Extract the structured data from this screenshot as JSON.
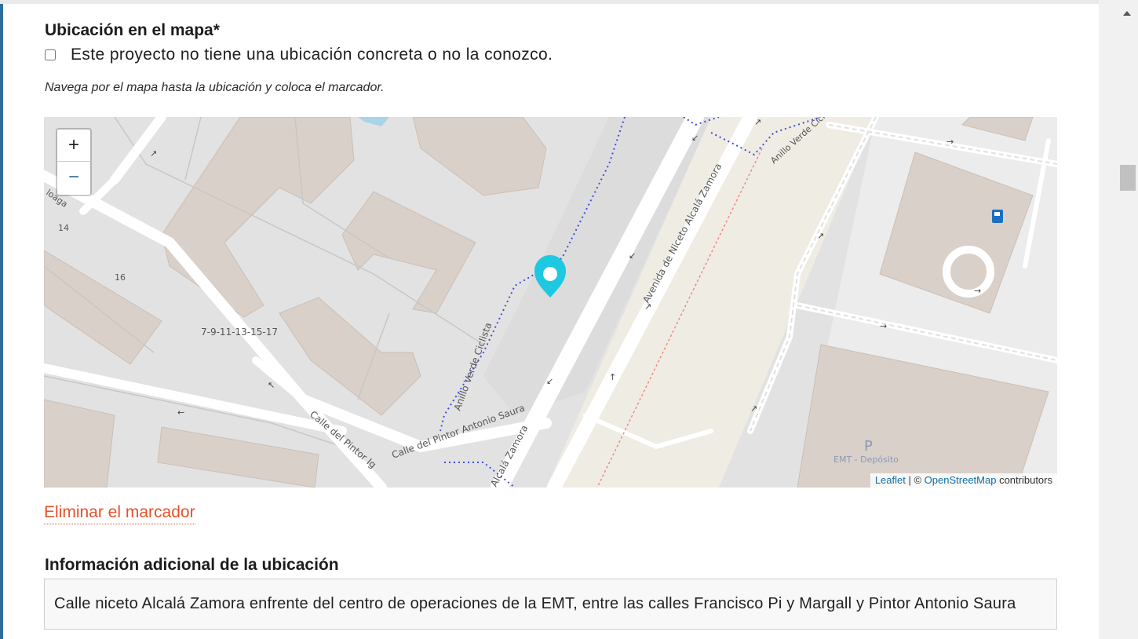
{
  "location": {
    "title": "Ubicación en el mapa*",
    "no_location_checkbox_label": "Este proyecto no tiene una ubicación concreta o no la conozco.",
    "hint": "Navega por el mapa hasta la ubicación y coloca el marcador."
  },
  "map": {
    "zoom_in": "+",
    "zoom_out": "−",
    "attribution": {
      "leaflet": "Leaflet",
      "separator": " | © ",
      "osm": "OpenStreetMap",
      "suffix": " contributors"
    },
    "street_labels": {
      "avenida": "Avenida de Niceto Alcalá Zamora",
      "avenida_lower": "Alcalá Zamora",
      "anillo_left": "Anillo Verde Ciclista",
      "anillo_top": "Anillo Verde Ciclista",
      "pintor_saura": "Calle del Pintor Antonio Saura",
      "pintor_ig": "Calle del Pintor Ig",
      "numbers": "7-9-11-13-15-17",
      "num_14": "14",
      "num_16": "16",
      "olaga": "loaga",
      "parking": "P",
      "emt": "EMT - Depósito"
    },
    "colors": {
      "marker": "#1ec8e0",
      "road": "#ffffff",
      "building": "#d9d0c9",
      "land": "#e0dfdf"
    }
  },
  "remove_marker_label": "Eliminar el marcador",
  "additional_info": {
    "label": "Información adicional de la ubicación",
    "value": "Calle niceto Alcalá Zamora enfrente del centro de operaciones de la EMT, entre las calles Francisco Pi y Margall y Pintor Antonio Saura"
  }
}
